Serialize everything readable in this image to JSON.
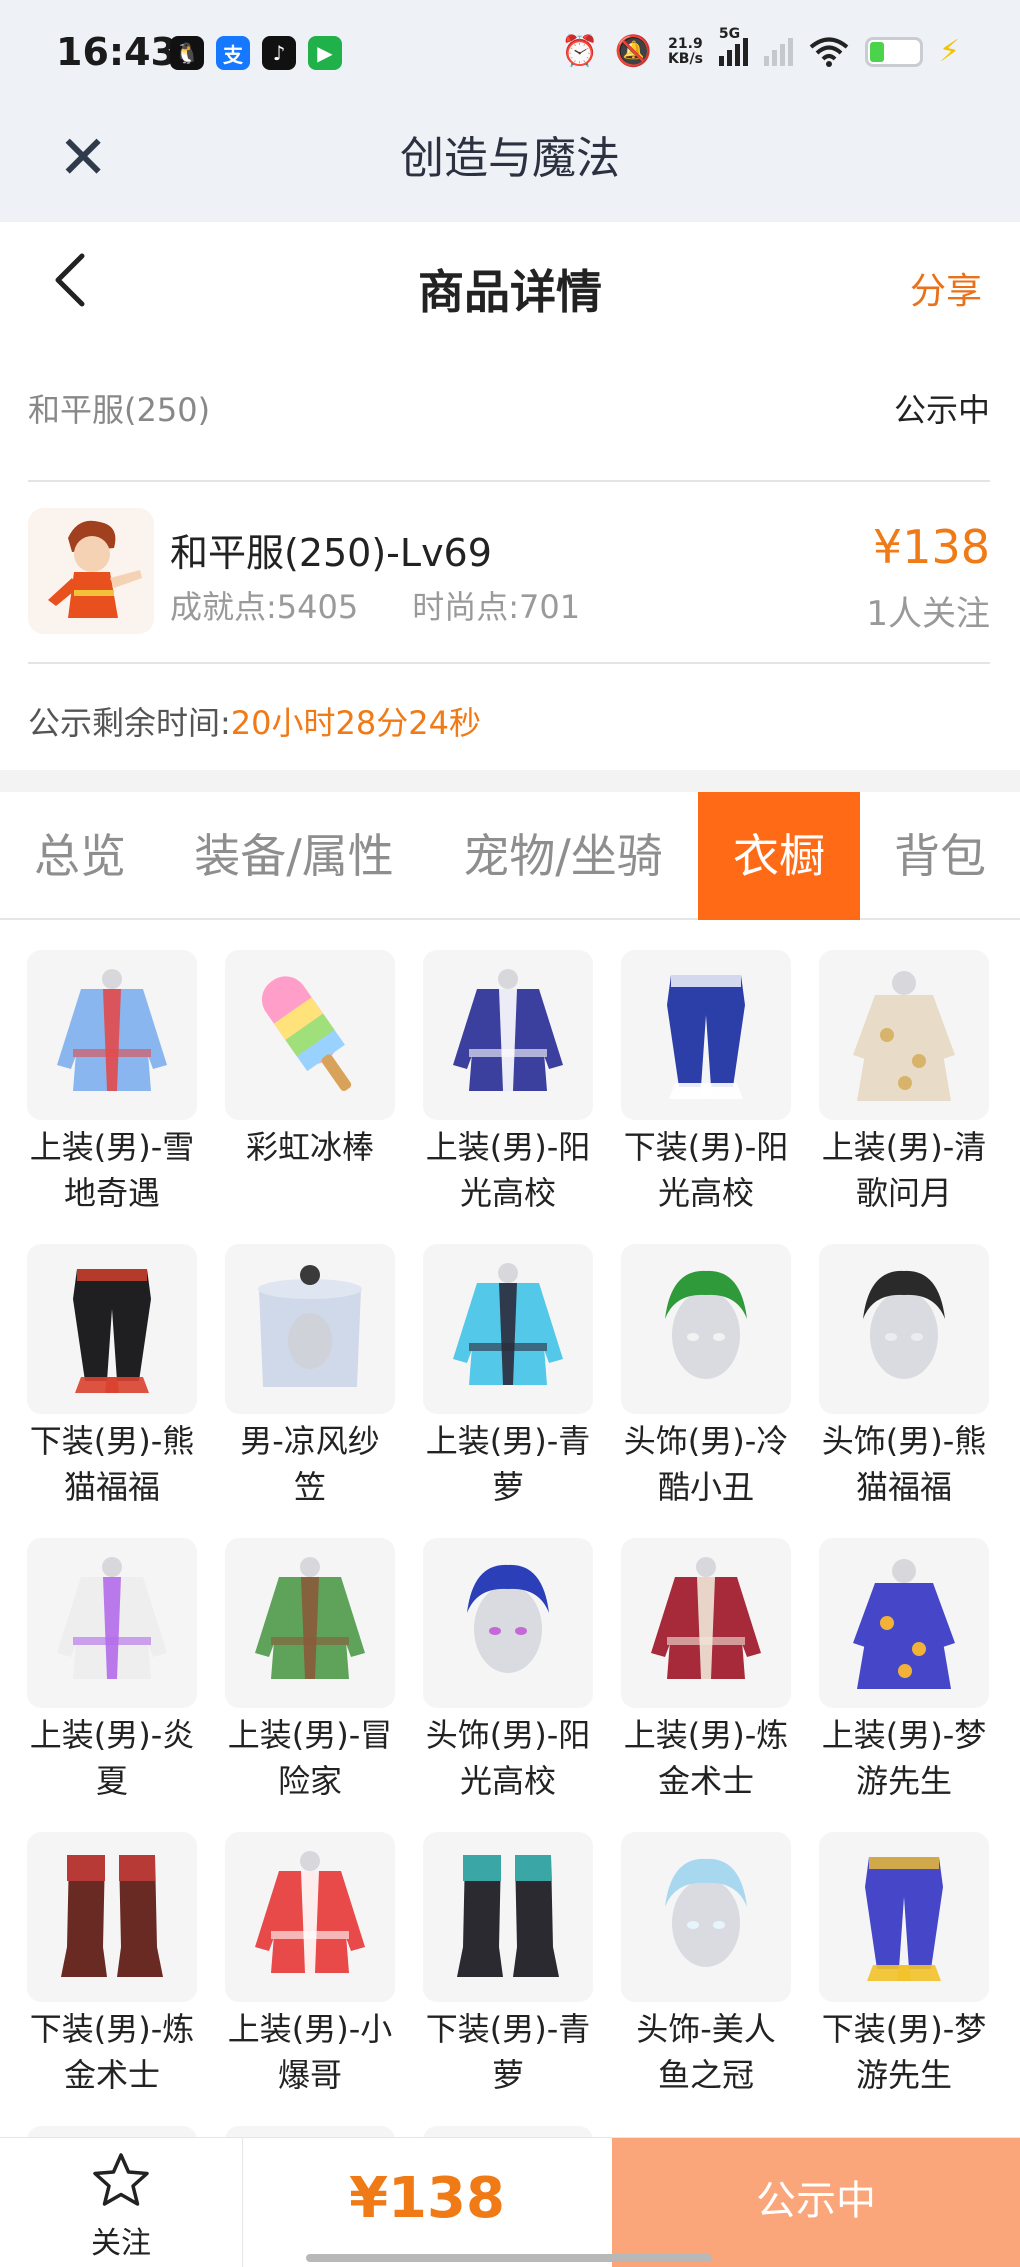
{
  "status_bar": {
    "time": "16:43",
    "net_speed_value": "21.9",
    "net_speed_unit": "KB/s",
    "network_label": "5G",
    "apps": [
      {
        "icon": "qq-icon",
        "color": "#111111",
        "glyph": "🐧"
      },
      {
        "icon": "alipay-icon",
        "color": "#1677ff",
        "glyph": "支"
      },
      {
        "icon": "tiktok-icon",
        "color": "#111111",
        "glyph": "♪"
      },
      {
        "icon": "video-app-icon",
        "color": "#20b14a",
        "glyph": "▶"
      }
    ]
  },
  "app_bar": {
    "title": "创造与魔法"
  },
  "page_header": {
    "title": "商品详情",
    "share_label": "分享"
  },
  "listing": {
    "server": "和平服(250)",
    "status": "公示中",
    "name": "和平服(250)-Lv69",
    "achievement_points": "成就点:5405",
    "fashion_points": "时尚点:701",
    "price": "¥138",
    "followers": "1人关注",
    "remaining_label": "公示剩余时间:",
    "remaining_value": "20小时28分24秒"
  },
  "tabs": [
    {
      "label": "总览",
      "active": false
    },
    {
      "label": "装备/属性",
      "active": false
    },
    {
      "label": "宠物/坐骑",
      "active": false
    },
    {
      "label": "衣橱",
      "active": true
    },
    {
      "label": "背包",
      "active": false
    }
  ],
  "wardrobe": [
    {
      "line1": "上装(男)-雪",
      "line2": "地奇遇",
      "kind": "top",
      "c1": "#8ab6f0",
      "c2": "#e24a4a"
    },
    {
      "line1": "彩虹冰棒",
      "line2": "",
      "kind": "popsicle",
      "c1": "#ff9ec8",
      "c2": "#9fe07a"
    },
    {
      "line1": "上装(男)-阳",
      "line2": "光高校",
      "kind": "top",
      "c1": "#3b3f9e",
      "c2": "#ffffff"
    },
    {
      "line1": "下装(男)-阳",
      "line2": "光高校",
      "kind": "pants",
      "c1": "#2c3fa8",
      "c2": "#ffffff"
    },
    {
      "line1": "上装(男)-清",
      "line2": "歌问月",
      "kind": "robe",
      "c1": "#e8dcc9",
      "c2": "#d7b46a"
    },
    {
      "line1": "下装(男)-熊",
      "line2": "猫福福",
      "kind": "pants",
      "c1": "#1f1f22",
      "c2": "#d9412d"
    },
    {
      "line1": "男-凉风纱",
      "line2": "笠",
      "kind": "hat",
      "c1": "#c9d4e6",
      "c2": "#3a3a3a"
    },
    {
      "line1": "上装(男)-青",
      "line2": "萝",
      "kind": "top",
      "c1": "#53c8e8",
      "c2": "#2b2b3b"
    },
    {
      "line1": "头饰(男)-冷",
      "line2": "酷小丑",
      "kind": "head",
      "c1": "#2f9a3a",
      "c2": "#f2f2f2"
    },
    {
      "line1": "头饰(男)-熊",
      "line2": "猫福福",
      "kind": "head",
      "c1": "#2a2a2a",
      "c2": "#e9edf2"
    },
    {
      "line1": "上装(男)-炎",
      "line2": "夏",
      "kind": "top",
      "c1": "#eeeeee",
      "c2": "#b36bea"
    },
    {
      "line1": "上装(男)-冒",
      "line2": "险家",
      "kind": "top",
      "c1": "#5fa35a",
      "c2": "#8a5a3a"
    },
    {
      "line1": "头饰(男)-阳",
      "line2": "光高校",
      "kind": "head",
      "c1": "#2a3fb8",
      "c2": "#c46ad6"
    },
    {
      "line1": "上装(男)-炼",
      "line2": "金术士",
      "kind": "top",
      "c1": "#a62a3a",
      "c2": "#f0e7d8"
    },
    {
      "line1": "上装(男)-梦",
      "line2": "游先生",
      "kind": "robe",
      "c1": "#4546c8",
      "c2": "#f2b238"
    },
    {
      "line1": "下装(男)-炼",
      "line2": "金术士",
      "kind": "boots",
      "c1": "#6a2a24",
      "c2": "#b83a36"
    },
    {
      "line1": "上装(男)-小",
      "line2": "爆哥",
      "kind": "top",
      "c1": "#e84a4a",
      "c2": "#ffffff"
    },
    {
      "line1": "下装(男)-青",
      "line2": "萝",
      "kind": "boots",
      "c1": "#2a2a30",
      "c2": "#3aa6a6"
    },
    {
      "line1": "头饰-美人",
      "line2": "鱼之冠",
      "kind": "head",
      "c1": "#a8d8f0",
      "c2": "#e8f4fb"
    },
    {
      "line1": "下装(男)-梦",
      "line2": "游先生",
      "kind": "pants",
      "c1": "#4546c8",
      "c2": "#f2c22a"
    }
  ],
  "bottom_bar": {
    "follow_label": "关注",
    "price": "¥138",
    "status_button": "公示中"
  },
  "colors": {
    "accent": "#f07a16",
    "tab_active_bg": "#ff6a16",
    "status_button_bg": "#fba57a"
  }
}
